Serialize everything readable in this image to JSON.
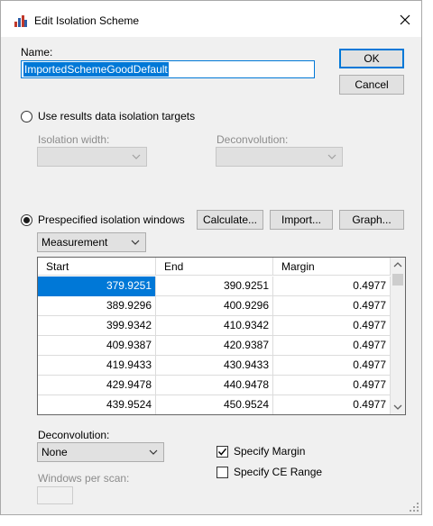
{
  "window": {
    "title": "Edit Isolation Scheme"
  },
  "name": {
    "label": "Name:",
    "value": "ImportedSchemeGoodDefault"
  },
  "buttons": {
    "ok": "OK",
    "cancel": "Cancel",
    "calculate": "Calculate...",
    "import": "Import...",
    "graph": "Graph..."
  },
  "results_option": {
    "label": "Use results data isolation targets",
    "selected": false,
    "isolation_width_label": "Isolation width:",
    "isolation_width_value": "",
    "deconvolution_label": "Deconvolution:",
    "deconvolution_value": ""
  },
  "prespecified_option": {
    "label": "Prespecified isolation windows",
    "selected": true,
    "type_selection": "Measurement"
  },
  "table": {
    "columns": [
      "Start",
      "End",
      "Margin"
    ],
    "rows": [
      [
        "379.9251",
        "390.9251",
        "0.4977"
      ],
      [
        "389.9296",
        "400.9296",
        "0.4977"
      ],
      [
        "399.9342",
        "410.9342",
        "0.4977"
      ],
      [
        "409.9387",
        "420.9387",
        "0.4977"
      ],
      [
        "419.9433",
        "430.9433",
        "0.4977"
      ],
      [
        "429.9478",
        "440.9478",
        "0.4977"
      ],
      [
        "439.9524",
        "450.9524",
        "0.4977"
      ]
    ]
  },
  "deconvolution": {
    "label": "Deconvolution:",
    "value": "None"
  },
  "specify_margin": {
    "label": "Specify Margin",
    "checked": true
  },
  "specify_ce_range": {
    "label": "Specify CE Range",
    "checked": false
  },
  "windows_per_scan": {
    "label": "Windows per scan:",
    "value": ""
  }
}
